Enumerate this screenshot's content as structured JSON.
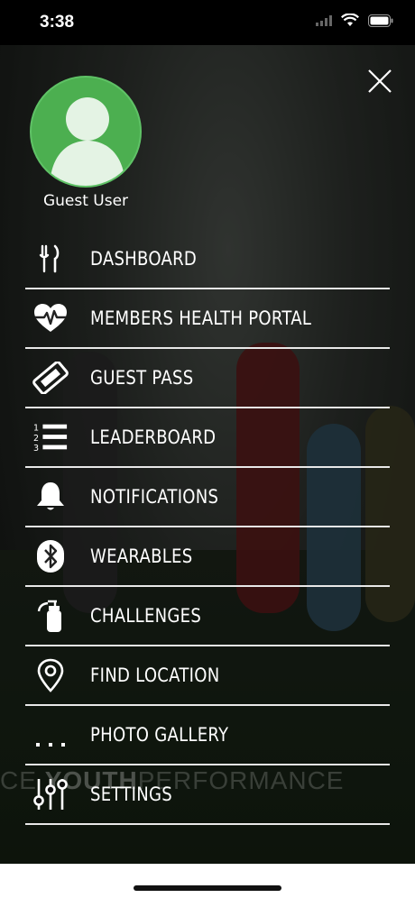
{
  "status_bar": {
    "time": "3:38"
  },
  "user": {
    "name": "Guest User"
  },
  "menu": {
    "items": [
      {
        "label": "DASHBOARD",
        "icon": "fork-knife-icon"
      },
      {
        "label": "MEMBERS HEALTH PORTAL",
        "icon": "heart-pulse-icon"
      },
      {
        "label": "GUEST PASS",
        "icon": "ticket-icon"
      },
      {
        "label": "LEADERBOARD",
        "icon": "ranked-list-icon"
      },
      {
        "label": "NOTIFICATIONS",
        "icon": "bell-icon"
      },
      {
        "label": "WEARABLES",
        "icon": "bluetooth-icon"
      },
      {
        "label": "CHALLENGES",
        "icon": "fire-extinguisher-icon"
      },
      {
        "label": "FIND LOCATION",
        "icon": "location-pin-icon"
      },
      {
        "label": "PHOTO GALLERY",
        "icon": "more-dots-icon"
      },
      {
        "label": "SETTINGS",
        "icon": "sliders-icon"
      }
    ]
  },
  "background": {
    "watermark_pre": "CE ",
    "watermark_bold": "YOUTH",
    "watermark_post": "PERFORMANCE"
  },
  "colors": {
    "avatar_bg": "#4caf50",
    "divider": "#e8e8e8"
  }
}
